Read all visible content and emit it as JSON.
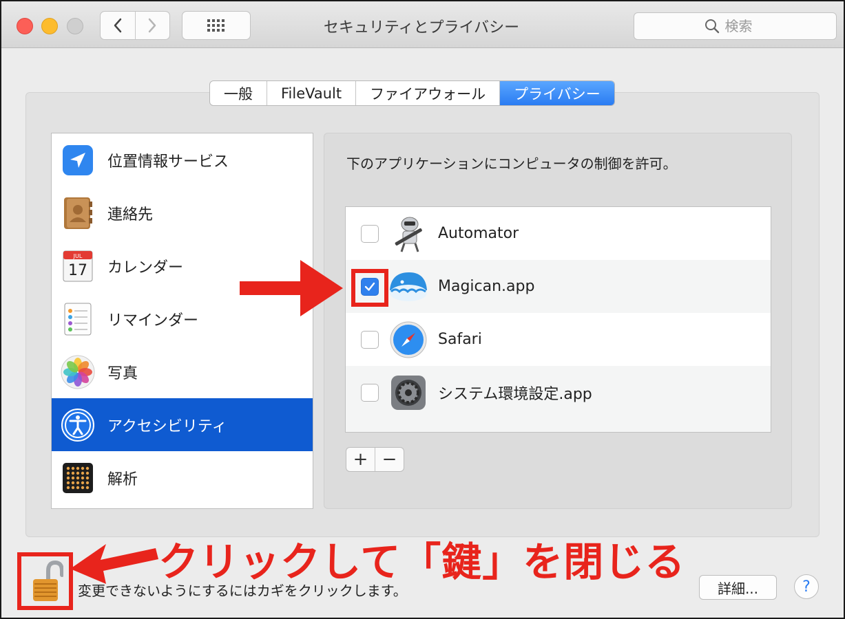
{
  "window": {
    "title": "セキュリティとプライバシー",
    "search_placeholder": "検索"
  },
  "tabs": [
    {
      "label": "一般",
      "active": false
    },
    {
      "label": "FileVault",
      "active": false
    },
    {
      "label": "ファイアウォール",
      "active": false
    },
    {
      "label": "プライバシー",
      "active": true
    }
  ],
  "sidebar": {
    "items": [
      {
        "label": "位置情報サービス",
        "icon": "location-arrow-icon"
      },
      {
        "label": "連絡先",
        "icon": "contacts-book-icon"
      },
      {
        "label": "カレンダー",
        "icon": "calendar-icon",
        "calendar_month": "JUL",
        "calendar_day": "17"
      },
      {
        "label": "リマインダー",
        "icon": "reminders-list-icon"
      },
      {
        "label": "写真",
        "icon": "photos-flower-icon"
      },
      {
        "label": "アクセシビリティ",
        "icon": "accessibility-figure-icon",
        "selected": true
      },
      {
        "label": "解析",
        "icon": "diagnostics-dots-icon"
      }
    ]
  },
  "pane": {
    "description": "下のアプリケーションにコンピュータの制御を許可。",
    "apps": [
      {
        "name": "Automator",
        "checked": false,
        "icon": "automator-robot-icon"
      },
      {
        "name": "Magican.app",
        "checked": true,
        "icon": "magican-whale-icon"
      },
      {
        "name": "Safari",
        "checked": false,
        "icon": "safari-compass-icon"
      },
      {
        "name": "システム環境設定.app",
        "checked": false,
        "icon": "system-preferences-gear-icon"
      }
    ],
    "add_label": "+",
    "remove_label": "−"
  },
  "footer": {
    "lock_text": "変更できないようにするにはカギをクリックします。",
    "detail_button": "詳細...",
    "help_button": "?"
  },
  "annotation": {
    "text": "クリックして「鍵」を閉じる"
  },
  "colors": {
    "selection": "#0f5bd1",
    "tab_active": "#2a7cf2",
    "annotation_red": "#e8241c",
    "checkbox_blue": "#2f80ed"
  }
}
